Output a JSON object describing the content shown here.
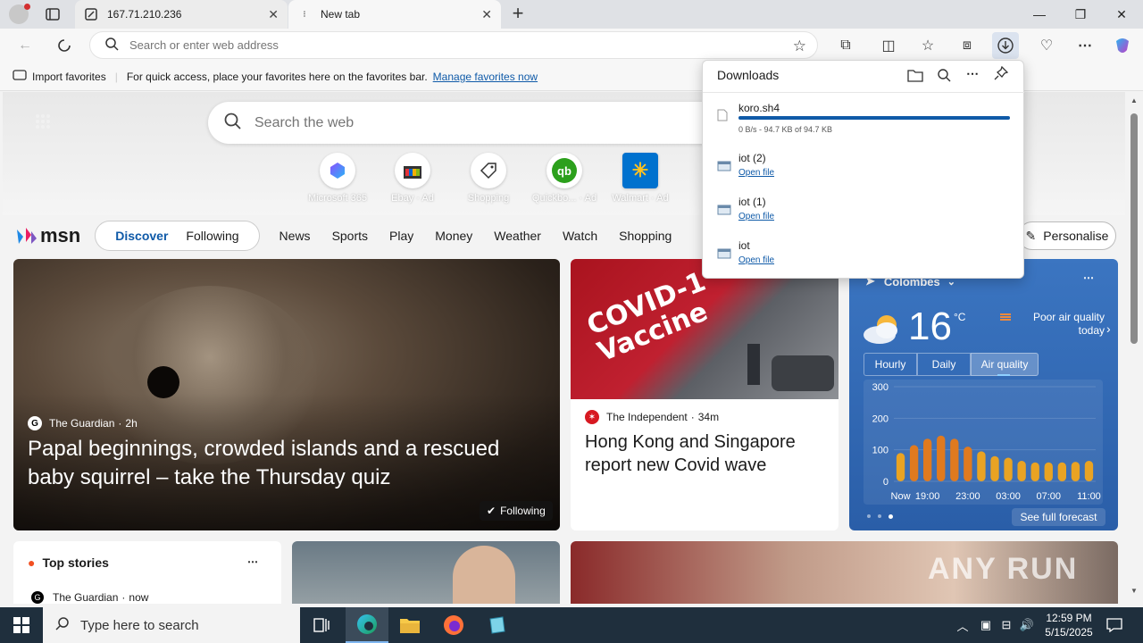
{
  "tabs": [
    {
      "title": "167.71.210.236",
      "active": false
    },
    {
      "title": "New tab",
      "active": true
    }
  ],
  "toolbar": {
    "address_placeholder": "Search or enter web address"
  },
  "favbar": {
    "import_label": "Import favorites",
    "message": "For quick access, place your favorites here on the favorites bar.",
    "manage_link": "Manage favorites now"
  },
  "search": {
    "placeholder": "Search the web"
  },
  "quick_links": [
    {
      "label": "Microsoft 365",
      "icon": "microsoft365-icon"
    },
    {
      "label": "Ebay · Ad",
      "icon": "ebay-icon"
    },
    {
      "label": "Shopping",
      "icon": "tag-icon"
    },
    {
      "label": "Quickbo... · Ad",
      "icon": "quickbooks-icon"
    },
    {
      "label": "Walmart · Ad",
      "icon": "walmart-icon"
    }
  ],
  "msn": {
    "logo": "msn",
    "pill": [
      "Discover",
      "Following"
    ],
    "nav": [
      "News",
      "Sports",
      "Play",
      "Money",
      "Weather",
      "Watch",
      "Shopping"
    ],
    "personalise": "Personalise"
  },
  "cards": {
    "main": {
      "source": "The Guardian",
      "age": "2h",
      "headline": "Papal beginnings, crowded islands and a rescued baby squirrel – take the Thursday quiz",
      "following": "Following"
    },
    "covid": {
      "source": "The Independent",
      "age": "34m",
      "headline": "Hong Kong and Singapore report new Covid wave",
      "image_text": "COVID-1 Vaccine"
    },
    "top_stories": {
      "title": "Top stories",
      "source": "The Guardian",
      "age": "now"
    }
  },
  "weather": {
    "location": "Colombes",
    "temp": "16",
    "unit": "°C",
    "air_quality": "Poor air quality today",
    "tabs": [
      "Hourly",
      "Daily",
      "Air quality"
    ],
    "active_tab": "Air quality",
    "see_full": "See full forecast",
    "chart_data": {
      "type": "bar",
      "categories": [
        "Now",
        "",
        "19:00",
        "",
        "",
        "23:00",
        "",
        "",
        "03:00",
        "",
        "",
        "07:00",
        "",
        "",
        "11:00"
      ],
      "x_ticks": [
        "Now",
        "19:00",
        "23:00",
        "03:00",
        "07:00",
        "11:00"
      ],
      "values": [
        90,
        115,
        135,
        145,
        135,
        110,
        95,
        80,
        75,
        65,
        60,
        60,
        60,
        62,
        65
      ],
      "ylim": [
        0,
        300
      ],
      "yticks": [
        0,
        100,
        200,
        300
      ]
    }
  },
  "downloads": {
    "title": "Downloads",
    "items": [
      {
        "name": "koro.sh4",
        "status": "0 B/s - 94.7 KB of 94.7 KB",
        "progress": 1.0,
        "link": ""
      },
      {
        "name": "iot (2)",
        "status": "",
        "link": "Open file"
      },
      {
        "name": "iot (1)",
        "status": "",
        "link": "Open file"
      },
      {
        "name": "iot",
        "status": "",
        "link": "Open file"
      }
    ]
  },
  "taskbar": {
    "search_placeholder": "Type here to search",
    "time": "12:59 PM",
    "date": "5/15/2025"
  },
  "watermark": "ANY RUN",
  "colors": {
    "accent": "#0f5aa8",
    "weather_bg": "#3b75c1",
    "bar": "#e69a1d",
    "taskbar": "#1f2f3d"
  }
}
